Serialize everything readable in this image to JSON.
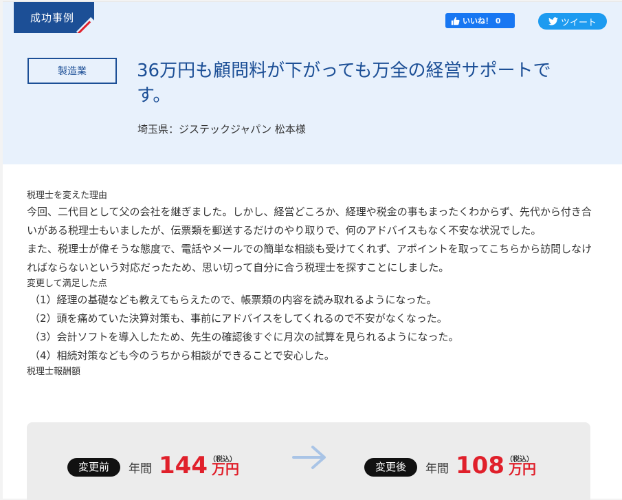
{
  "header": {
    "ribbon": "成功事例",
    "fb_like": "いいね！ 0",
    "tweet": "ツイート",
    "industry": "製造業",
    "title": "36万円も顧問料が下がっても万全の経営サポートです。",
    "client": "埼玉県：ジステックジャパン 松本様"
  },
  "content": {
    "reason_label": "税理士を変えた理由",
    "reason_para1": "今回、二代目として父の会社を継ぎました。しかし、経営どころか、経理や税金の事もまったくわからず、先代から付き合いがある税理士もいましたが、伝票類を郵送するだけのやり取りで、何のアドバイスもなく不安な状況でした。",
    "reason_para2": "また、税理士が偉そうな態度で、電話やメールでの簡単な相談も受けてくれず、アポイントを取ってこちらから訪問しなければならないという対応だったため、思い切って自分に合う税理士を探すことにしました。",
    "satisfied_label": "変更して満足した点",
    "points": [
      "（1）経理の基礎なども教えてもらえたので、帳票類の内容を読み取れるようになった。",
      "（2）頭を痛めていた決算対策も、事前にアドバイスをしてくれるので不安がなくなった。",
      "（3）会計ソフトを導入したため、先生の確認後すぐに月次の試算を見られるようになった。",
      "（4）相続対策なども今のうちから相談ができることで安心した。"
    ],
    "fee_label": "税理士報酬額"
  },
  "fee": {
    "before_label": "変更前",
    "before_period": "年間",
    "before_amount": "144",
    "after_label": "変更後",
    "after_period": "年間",
    "after_amount": "108",
    "tax": "（税込）",
    "unit": "万円"
  },
  "colors": {
    "navy": "#1c4f96",
    "red": "#e0202b",
    "header_bg": "#e8f1fc",
    "arrow": "#a9c4e6"
  },
  "icons": {
    "fb": "thumbs-up-icon",
    "tw": "twitter-bird-icon",
    "arrow": "right-arrow-icon"
  }
}
